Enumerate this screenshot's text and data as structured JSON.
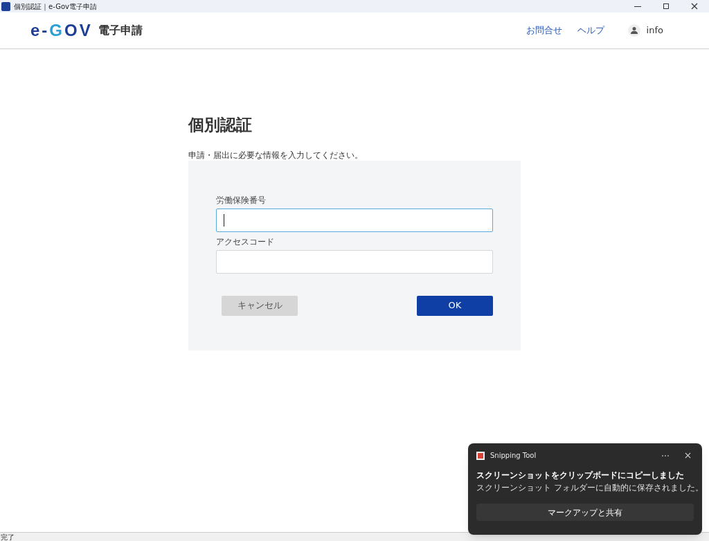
{
  "window": {
    "title": "個別認証｜e-Gov電子申請"
  },
  "header": {
    "logo": {
      "parts": [
        {
          "text": "e-",
          "color": "#1e3f96"
        },
        {
          "text": "G",
          "color": "#2a9fd8"
        },
        {
          "text": "OV",
          "color": "#1e3f96"
        }
      ],
      "subtitle": "電子申請"
    },
    "links": [
      "お問合せ",
      "ヘルプ"
    ],
    "user": "info"
  },
  "page": {
    "title": "個別認証",
    "description": "申請・届出に必要な情報を入力してください。",
    "fields": [
      {
        "label": "労働保険番号",
        "focused": true
      },
      {
        "label": "アクセスコード",
        "focused": false
      }
    ],
    "buttons": [
      {
        "label": "キャンセル",
        "kind": "secondary"
      },
      {
        "label": "OK",
        "kind": "primary"
      }
    ]
  },
  "toast": {
    "app": "Snipping Tool",
    "title": "スクリーンショットをクリップボードにコピーしました",
    "message": "スクリーンショット フォルダーに自動的に保存されました。",
    "action": "マークアップと共有"
  },
  "status_bar": "完了"
}
